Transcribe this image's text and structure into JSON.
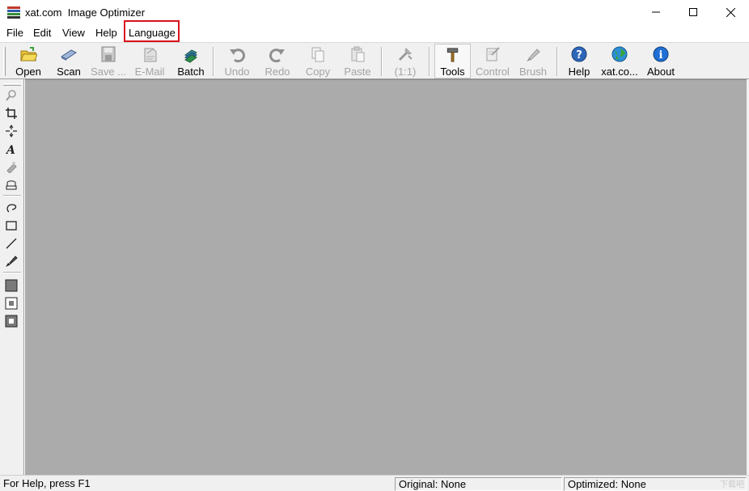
{
  "window": {
    "title": "xat.com  Image Optimizer",
    "controls": {
      "minimize": "minimize",
      "maximize": "maximize",
      "close": "close"
    }
  },
  "menu": {
    "items": [
      "File",
      "Edit",
      "View",
      "Help",
      "Language"
    ],
    "highlighted": "Language",
    "highlight_color": "#d8121a"
  },
  "toolbar": {
    "buttons": [
      {
        "label": "Open",
        "icon": "open-folder-icon",
        "enabled": true
      },
      {
        "label": "Scan",
        "icon": "scanner-icon",
        "enabled": true
      },
      {
        "label": "Save ...",
        "icon": "save-disk-icon",
        "enabled": false
      },
      {
        "label": "E-Mail",
        "icon": "email-icon",
        "enabled": false
      },
      {
        "label": "Batch",
        "icon": "batch-icon",
        "enabled": true
      },
      {
        "label": "Undo",
        "icon": "undo-icon",
        "enabled": false
      },
      {
        "label": "Redo",
        "icon": "redo-icon",
        "enabled": false
      },
      {
        "label": "Copy",
        "icon": "copy-icon",
        "enabled": false
      },
      {
        "label": "Paste",
        "icon": "paste-icon",
        "enabled": false
      },
      {
        "label": "(1:1)",
        "icon": "zoom-actual-size-icon",
        "enabled": false
      },
      {
        "label": "Tools",
        "icon": "tools-hammer-icon",
        "enabled": true,
        "pressed": true
      },
      {
        "label": "Control",
        "icon": "control-icon",
        "enabled": false
      },
      {
        "label": "Brush",
        "icon": "brush-icon",
        "enabled": false
      },
      {
        "label": "Help",
        "icon": "help-icon",
        "enabled": true
      },
      {
        "label": "xat.co...",
        "icon": "globe-icon",
        "enabled": true
      },
      {
        "label": "About",
        "icon": "info-icon",
        "enabled": true
      }
    ]
  },
  "left_tools": [
    "magnifier-icon",
    "crop-icon",
    "resize-icon",
    "text-icon",
    "filter-icon",
    "stamp-icon",
    "lasso-icon",
    "rectangle-icon",
    "line-icon",
    "paint-brush-icon",
    "foreground-color-icon",
    "fill-mode-icon",
    "background-color-icon"
  ],
  "canvas": {
    "background": "#ababab"
  },
  "status": {
    "help_text": "For Help, press F1",
    "original": "Original: None",
    "optimized": "Optimized: None"
  },
  "watermark": "下载吧"
}
